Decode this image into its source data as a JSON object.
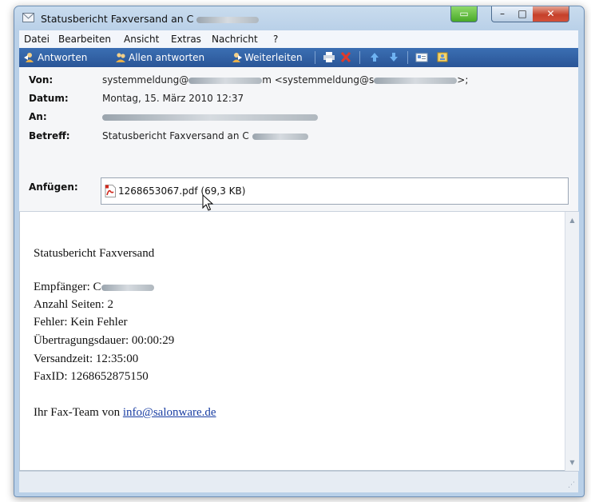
{
  "window": {
    "title": "Statusbericht Faxversand an C",
    "controls": {
      "restore": "▭",
      "minimize": "–",
      "maximize": "□",
      "close": "✕"
    }
  },
  "menu": [
    "Datei",
    "Bearbeiten",
    "Ansicht",
    "Extras",
    "Nachricht",
    "?"
  ],
  "toolbar": {
    "reply": "Antworten",
    "reply_all": "Allen antworten",
    "forward": "Weiterleiten"
  },
  "header": {
    "from_label": "Von:",
    "from_value_start": "systemmeldung@",
    "from_value_mid": "m <systemmeldung@s",
    "from_value_end": ">;",
    "date_label": "Datum:",
    "date_value": "Montag, 15. März 2010 12:37",
    "to_label": "An:",
    "subject_label": "Betreff:",
    "subject_value": "Statusbericht Faxversand an C",
    "attach_label": "Anfügen:",
    "attachment": "1268653067.pdf (69,3 KB)"
  },
  "body": {
    "heading": "Statusbericht Faxversand",
    "recipient": "Empfänger: C",
    "pages": "Anzahl Seiten: 2",
    "error": "Fehler: Kein Fehler",
    "duration": "Übertragungsdauer: 00:00:29",
    "send_time": "Versandzeit: 12:35:00",
    "fax_id": "FaxID: 1268652875150",
    "signature_prefix": "Ihr Fax-Team von ",
    "signature_link": "info@salonware.de"
  },
  "colors": {
    "toolbar": "#2f5fa3",
    "link": "#1a3ea3",
    "close_button": "#c5412a",
    "green_button": "#49a928"
  },
  "icons": {
    "title": "envelope-icon",
    "reply": "reply-person-icon",
    "reply_all": "reply-all-persons-icon",
    "forward": "forward-person-icon",
    "print": "printer-icon",
    "delete": "red-x-delete-icon",
    "previous": "arrow-up-icon",
    "next": "arrow-down-icon",
    "addresses": "address-card-icon",
    "contacts": "contacts-book-icon",
    "attachment": "pdf-file-icon"
  }
}
